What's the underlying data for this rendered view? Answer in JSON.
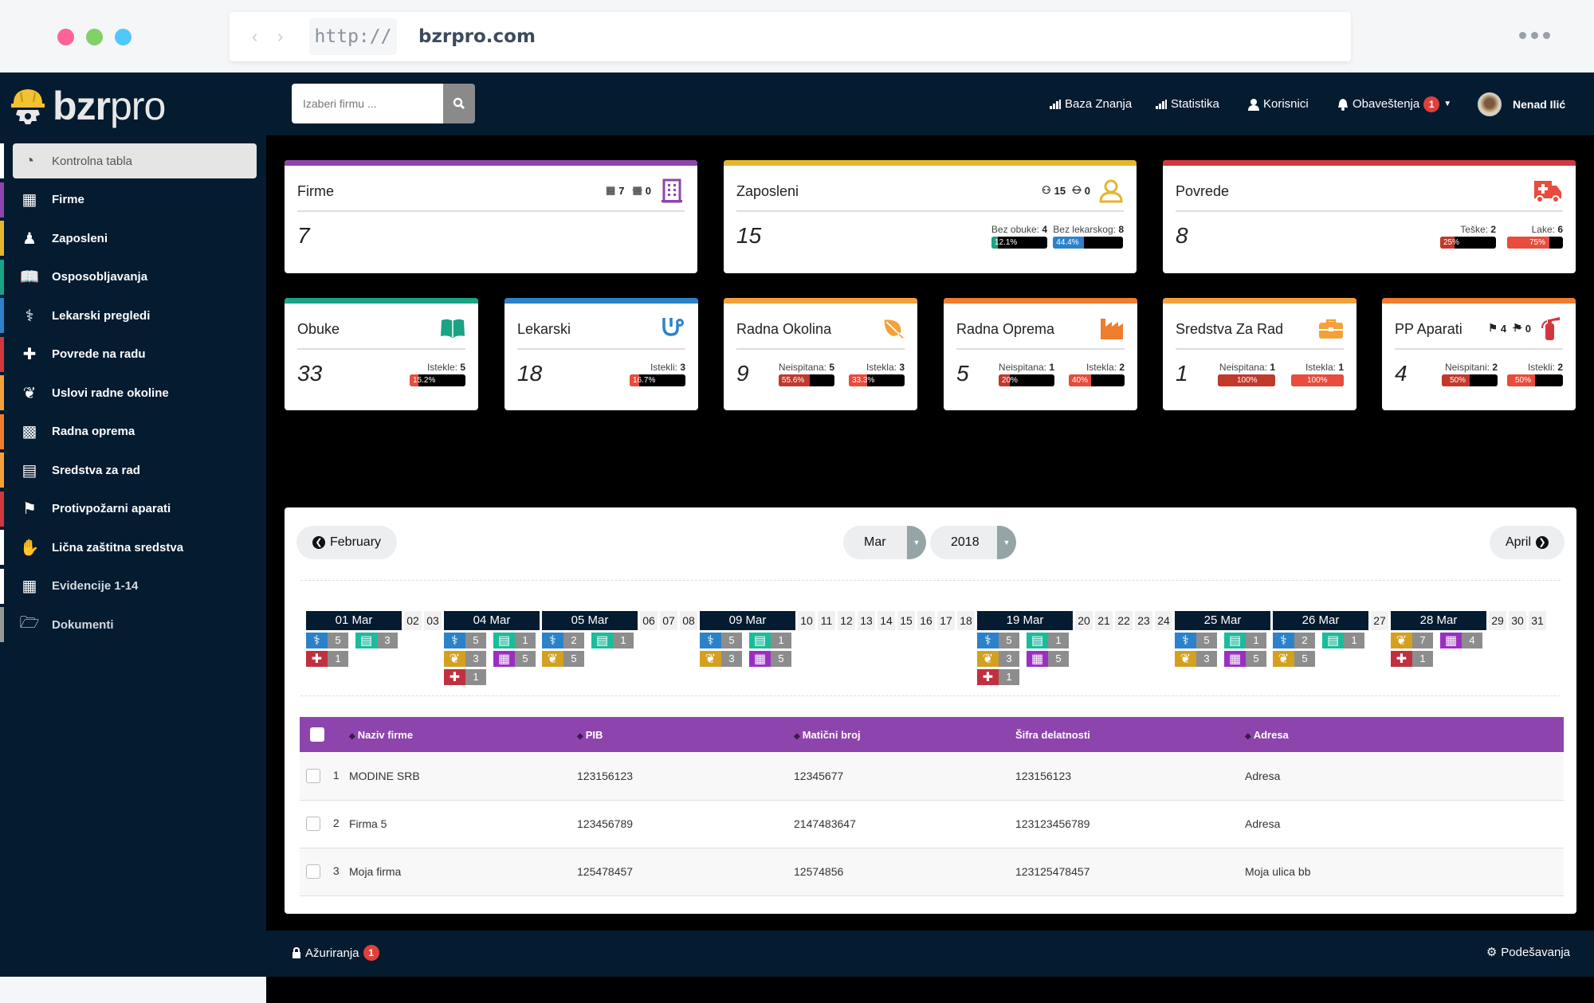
{
  "browser": {
    "url_protocol": "http://",
    "url_host": "bzrpro.com",
    "dot_colors": [
      "#ff6296",
      "#81d167",
      "#4fc8fb"
    ]
  },
  "app": {
    "logo_bold": "bzr",
    "logo_light": "pro"
  },
  "search": {
    "placeholder": "Izaberi firmu ..."
  },
  "topnav": {
    "items": [
      {
        "label": "Baza Znanja",
        "icon": "bar-chart-icon"
      },
      {
        "label": "Statistika",
        "icon": "bar-chart-icon"
      },
      {
        "label": "Korisnici",
        "icon": "user-icon"
      },
      {
        "label": "Obaveštenja",
        "icon": "bell-icon",
        "badge": "1"
      }
    ],
    "user_name": "Nenad Ilić"
  },
  "sidebar": {
    "items": [
      {
        "label": "Kontrolna tabla",
        "icon": "dashboard-icon",
        "color": "#ffffff",
        "active": true
      },
      {
        "label": "Firme",
        "icon": "building-icon",
        "color": "#8e44ad"
      },
      {
        "label": "Zaposleni",
        "icon": "user-icon",
        "color": "#e5b530"
      },
      {
        "label": "Osposobljavanja",
        "icon": "book-icon",
        "color": "#1aa385"
      },
      {
        "label": "Lekarski pregledi",
        "icon": "stethoscope-icon",
        "color": "#2c82c9"
      },
      {
        "label": "Povrede na radu",
        "icon": "ambulance-icon",
        "color": "#d0383e"
      },
      {
        "label": "Uslovi radne okoline",
        "icon": "leaf-icon",
        "color": "#f4a13a"
      },
      {
        "label": "Radna oprema",
        "icon": "industry-icon",
        "color": "#f07c2e"
      },
      {
        "label": "Sredstva za rad",
        "icon": "briefcase-icon",
        "color": "#f4a13a"
      },
      {
        "label": "Protivpožarni aparati",
        "icon": "fire-extinguisher-icon",
        "color": "#d0383e"
      },
      {
        "label": "Lična zaštitna sredstva",
        "icon": "gloves-icon",
        "color": "#ffffff"
      },
      {
        "label": "Evidencije 1-14",
        "icon": "building-icon",
        "color": "#ffffff"
      },
      {
        "label": "Dokumenti",
        "icon": "folder-open-icon",
        "color": "#999999"
      }
    ]
  },
  "cards": {
    "firme": {
      "title": "Firme",
      "value": "7",
      "active": "7",
      "inactive": "0",
      "color": "#8e44ad"
    },
    "zaposleni": {
      "title": "Zaposleni",
      "value": "15",
      "active": "15",
      "inactive": "0",
      "color": "#e5b530",
      "stats": [
        {
          "label": "Bez obuke:",
          "value": "4",
          "percent": 12.1,
          "percent_label": "12.1%",
          "color": "#1aa385"
        },
        {
          "label": "Bez lekarskog:",
          "value": "8",
          "percent": 44.4,
          "percent_label": "44.4%",
          "color": "#2c82c9"
        }
      ]
    },
    "povrede": {
      "title": "Povrede",
      "value": "8",
      "color": "#d0383e",
      "stats": [
        {
          "label": "Teške:",
          "value": "2",
          "percent": 25,
          "percent_label": "25%",
          "color": "#c0392b"
        },
        {
          "label": "Lake:",
          "value": "6",
          "percent": 75,
          "percent_label": "75%",
          "color": "#e74c3c"
        }
      ]
    },
    "obuke": {
      "title": "Obuke",
      "value": "33",
      "color": "#1aa385",
      "stats": [
        {
          "label": "Istekle:",
          "value": "5",
          "percent": 15.2,
          "percent_label": "15.2%",
          "color": "#e74c3c"
        }
      ]
    },
    "lekarski": {
      "title": "Lekarski",
      "value": "18",
      "color": "#2c82c9",
      "stats": [
        {
          "label": "Istekli:",
          "value": "3",
          "percent": 16.7,
          "percent_label": "16.7%",
          "color": "#e74c3c"
        }
      ]
    },
    "okolina": {
      "title": "Radna Okolina",
      "value": "9",
      "color": "#f4a13a",
      "stats": [
        {
          "label": "Neispitana:",
          "value": "5",
          "percent": 55.6,
          "percent_label": "55.6%",
          "color": "#c0392b"
        },
        {
          "label": "Istekla:",
          "value": "3",
          "percent": 33.3,
          "percent_label": "33.3%",
          "color": "#e74c3c"
        }
      ]
    },
    "oprema": {
      "title": "Radna Oprema",
      "value": "5",
      "color": "#f07c2e",
      "stats": [
        {
          "label": "Neispitana:",
          "value": "1",
          "percent": 20,
          "percent_label": "20%",
          "color": "#c0392b"
        },
        {
          "label": "Istekla:",
          "value": "2",
          "percent": 40,
          "percent_label": "40%",
          "color": "#e74c3c"
        }
      ]
    },
    "sredstva": {
      "title": "Sredstva Za Rad",
      "value": "1",
      "color": "#f4a13a",
      "stats": [
        {
          "label": "Neispitana:",
          "value": "1",
          "percent": 100,
          "percent_label": "100%",
          "color": "#c0392b"
        },
        {
          "label": "Istekla:",
          "value": "1",
          "percent": 100,
          "percent_label": "100%",
          "color": "#e74c3c"
        }
      ]
    },
    "pp": {
      "title": "PP Aparati",
      "value": "4",
      "active": "4",
      "inactive": "0",
      "color": "#f07c2e",
      "stats": [
        {
          "label": "Neispitani:",
          "value": "2",
          "percent": 50,
          "percent_label": "50%",
          "color": "#c0392b"
        },
        {
          "label": "Istekli:",
          "value": "2",
          "percent": 50,
          "percent_label": "50%",
          "color": "#e74c3c"
        }
      ]
    }
  },
  "calendar": {
    "prev_label": "February",
    "next_label": "April",
    "month": "Mar",
    "year": "2018",
    "days": [
      {
        "day": "01 Mar",
        "events": [
          [
            "stethoscope",
            "5"
          ],
          [
            "book",
            "3"
          ],
          [
            "ambulance",
            "1"
          ]
        ]
      },
      {
        "day": "02"
      },
      {
        "day": "03"
      },
      {
        "day": "04 Mar",
        "events": [
          [
            "stethoscope",
            "5"
          ],
          [
            "book",
            "1"
          ],
          [
            "leaf",
            "3"
          ],
          [
            "building",
            "5"
          ],
          [
            "ambulance",
            "1"
          ]
        ]
      },
      {
        "day": "05 Mar",
        "events": [
          [
            "stethoscope",
            "2"
          ],
          [
            "book",
            "1"
          ],
          [
            "leaf",
            "5"
          ]
        ]
      },
      {
        "day": "06"
      },
      {
        "day": "07"
      },
      {
        "day": "08"
      },
      {
        "day": "09 Mar",
        "events": [
          [
            "stethoscope",
            "5"
          ],
          [
            "book",
            "1"
          ],
          [
            "leaf",
            "3"
          ],
          [
            "building",
            "5"
          ]
        ]
      },
      {
        "day": "10"
      },
      {
        "day": "11"
      },
      {
        "day": "12"
      },
      {
        "day": "13"
      },
      {
        "day": "14"
      },
      {
        "day": "15"
      },
      {
        "day": "16"
      },
      {
        "day": "17"
      },
      {
        "day": "18"
      },
      {
        "day": "19 Mar",
        "events": [
          [
            "stethoscope",
            "5"
          ],
          [
            "book",
            "1"
          ],
          [
            "leaf",
            "3"
          ],
          [
            "building",
            "5"
          ],
          [
            "ambulance",
            "1"
          ]
        ]
      },
      {
        "day": "20"
      },
      {
        "day": "21"
      },
      {
        "day": "22"
      },
      {
        "day": "23"
      },
      {
        "day": "24"
      },
      {
        "day": "25 Mar",
        "events": [
          [
            "stethoscope",
            "5"
          ],
          [
            "book",
            "1"
          ],
          [
            "leaf",
            "3"
          ],
          [
            "building",
            "5"
          ]
        ]
      },
      {
        "day": "26 Mar",
        "events": [
          [
            "stethoscope",
            "2"
          ],
          [
            "book",
            "1"
          ],
          [
            "leaf",
            "5"
          ]
        ]
      },
      {
        "day": "27"
      },
      {
        "day": "28 Mar",
        "events": [
          [
            "leaf",
            "7"
          ],
          [
            "building",
            "4"
          ],
          [
            "ambulance",
            "1"
          ]
        ]
      },
      {
        "day": "29"
      },
      {
        "day": "30"
      },
      {
        "day": "31"
      }
    ]
  },
  "table": {
    "columns": [
      "Naziv firme",
      "PIB",
      "Matični broj",
      "Šifra delatnosti",
      "Adresa"
    ],
    "rows": [
      {
        "num": "1",
        "naziv": "MODINE SRB",
        "pib": "123156123",
        "mb": "12345677",
        "sifra": "123156123",
        "adresa": "Adresa"
      },
      {
        "num": "2",
        "naziv": "Firma 5",
        "pib": "123456789",
        "mb": "2147483647",
        "sifra": "123123456789",
        "adresa": "Adresa"
      },
      {
        "num": "3",
        "naziv": "Moja firma",
        "pib": "125478457",
        "mb": "12574856",
        "sifra": "123125478457",
        "adresa": "Moja ulica bb"
      }
    ]
  },
  "footer": {
    "updates_label": "Ažuriranja",
    "updates_badge": "1",
    "settings_label": "Podešavanja"
  }
}
